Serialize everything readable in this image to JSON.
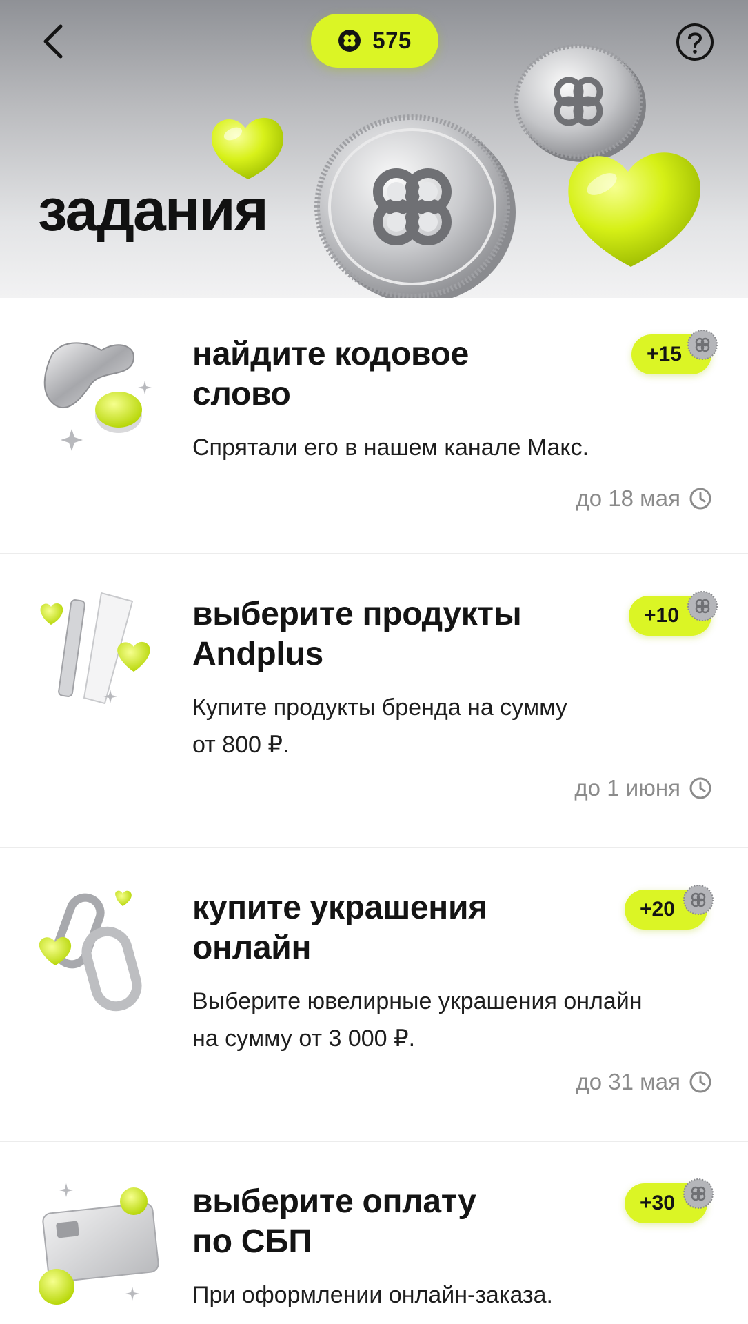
{
  "header": {
    "back_icon": "chevron-left-icon",
    "points": "575",
    "points_icon": "clover-coin-icon",
    "help_icon": "question-circle-icon",
    "title": "задания"
  },
  "colors": {
    "accent": "#dbf525",
    "text": "#141414",
    "muted": "#8b8b8b",
    "header_bg": "#b9babd"
  },
  "tasks": [
    {
      "title": "найдите кодовое\nслово",
      "description": "Спрятали его в нашем канале Макс.",
      "reward": "+15",
      "deadline": "до 18 мая",
      "icon": "silver-gua-sha-icon"
    },
    {
      "title": "выберите продукты\nAndplus",
      "description": "Купите продукты бренда на сумму\nот 800 ₽.",
      "reward": "+10",
      "deadline": "до 1 июня",
      "icon": "cosmetics-tubes-icon"
    },
    {
      "title": "купите украшения\nонлайн",
      "description": "Выберите ювелирные украшения онлайн\nна сумму от 3 000 ₽.",
      "reward": "+20",
      "deadline": "до 31 мая",
      "icon": "silver-earrings-icon"
    },
    {
      "title": "выберите оплату\nпо СБП",
      "description": "При оформлении онлайн-заказа.",
      "reward": "+30",
      "deadline": "",
      "icon": "bank-card-icon"
    }
  ]
}
